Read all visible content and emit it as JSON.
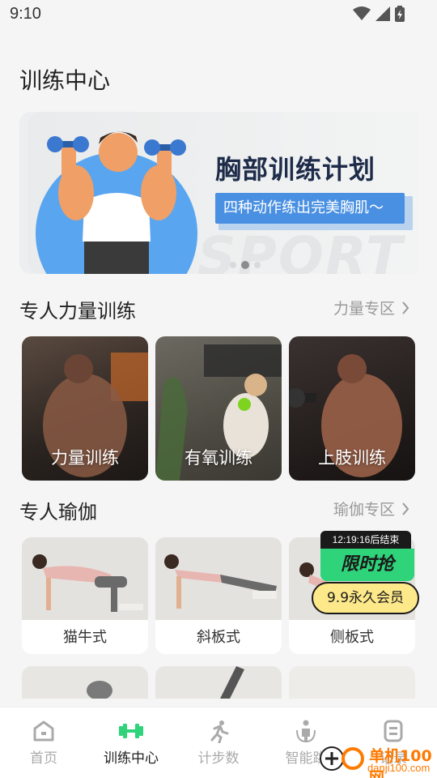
{
  "status_bar": {
    "time": "9:10"
  },
  "page_title": "训练中心",
  "banner": {
    "headline": "胸部训练计划",
    "subtitle": "四种动作练出完美胸肌～",
    "watermark_text": "SPORT"
  },
  "strength_section": {
    "title": "专人力量训练",
    "link_label": "力量专区",
    "cards": [
      {
        "label": "力量训练"
      },
      {
        "label": "有氧训练"
      },
      {
        "label": "上肢训练"
      }
    ]
  },
  "yoga_section": {
    "title": "专人瑜伽",
    "link_label": "瑜伽专区",
    "cards": [
      {
        "label": "猫牛式"
      },
      {
        "label": "斜板式"
      },
      {
        "label": "侧板式"
      }
    ]
  },
  "promo": {
    "countdown": "12:19:16后结束",
    "title": "限时抢",
    "offer": "9.9永久会员"
  },
  "bottom_nav": [
    {
      "label": "首页",
      "icon": "home-icon",
      "active": false
    },
    {
      "label": "训练中心",
      "icon": "dumbbell-icon",
      "active": true
    },
    {
      "label": "计步数",
      "icon": "running-icon",
      "active": false
    },
    {
      "label": "智能跳",
      "icon": "jump-rope-icon",
      "active": false
    },
    {
      "label": "记录",
      "icon": "record-icon",
      "active": false
    }
  ],
  "watermark": {
    "name": "单机100网",
    "url": "danji100.com"
  },
  "colors": {
    "accent_green": "#2fd37a",
    "banner_blue": "#4a90e2",
    "promo_yellow": "#fde88a"
  }
}
